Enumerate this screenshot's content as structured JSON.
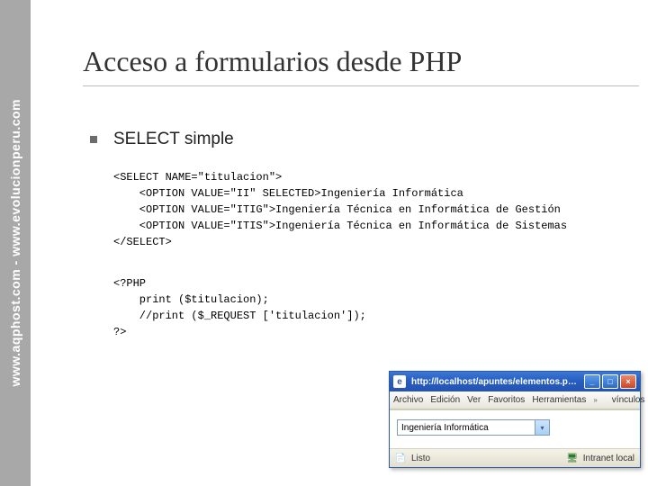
{
  "sidebar": {
    "text": "www.aqphost.com - www.evolucionperu.com"
  },
  "slide": {
    "title": "Acceso a formularios desde PHP",
    "bullet_label": "SELECT simple",
    "code1": "<SELECT NAME=\"titulacion\">\n    <OPTION VALUE=\"II\" SELECTED>Ingeniería Informática\n    <OPTION VALUE=\"ITIG\">Ingeniería Técnica en Informática de Gestión\n    <OPTION VALUE=\"ITIS\">Ingeniería Técnica en Informática de Sistemas\n</SELECT>",
    "code2": "<?PHP\n    print ($titulacion);\n    //print ($_REQUEST ['titulacion']);\n?>"
  },
  "browser": {
    "title": "http://localhost/apuntes/elementos.php - Micros...",
    "menu": {
      "archivo": "Archivo",
      "edicion": "Edición",
      "ver": "Ver",
      "favoritos": "Favoritos",
      "herramientas": "Herramientas",
      "vinculos": "vínculos"
    },
    "selected_value": "Ingeniería Informática",
    "status_text": "Listo",
    "zone_text": "Intranet local"
  }
}
